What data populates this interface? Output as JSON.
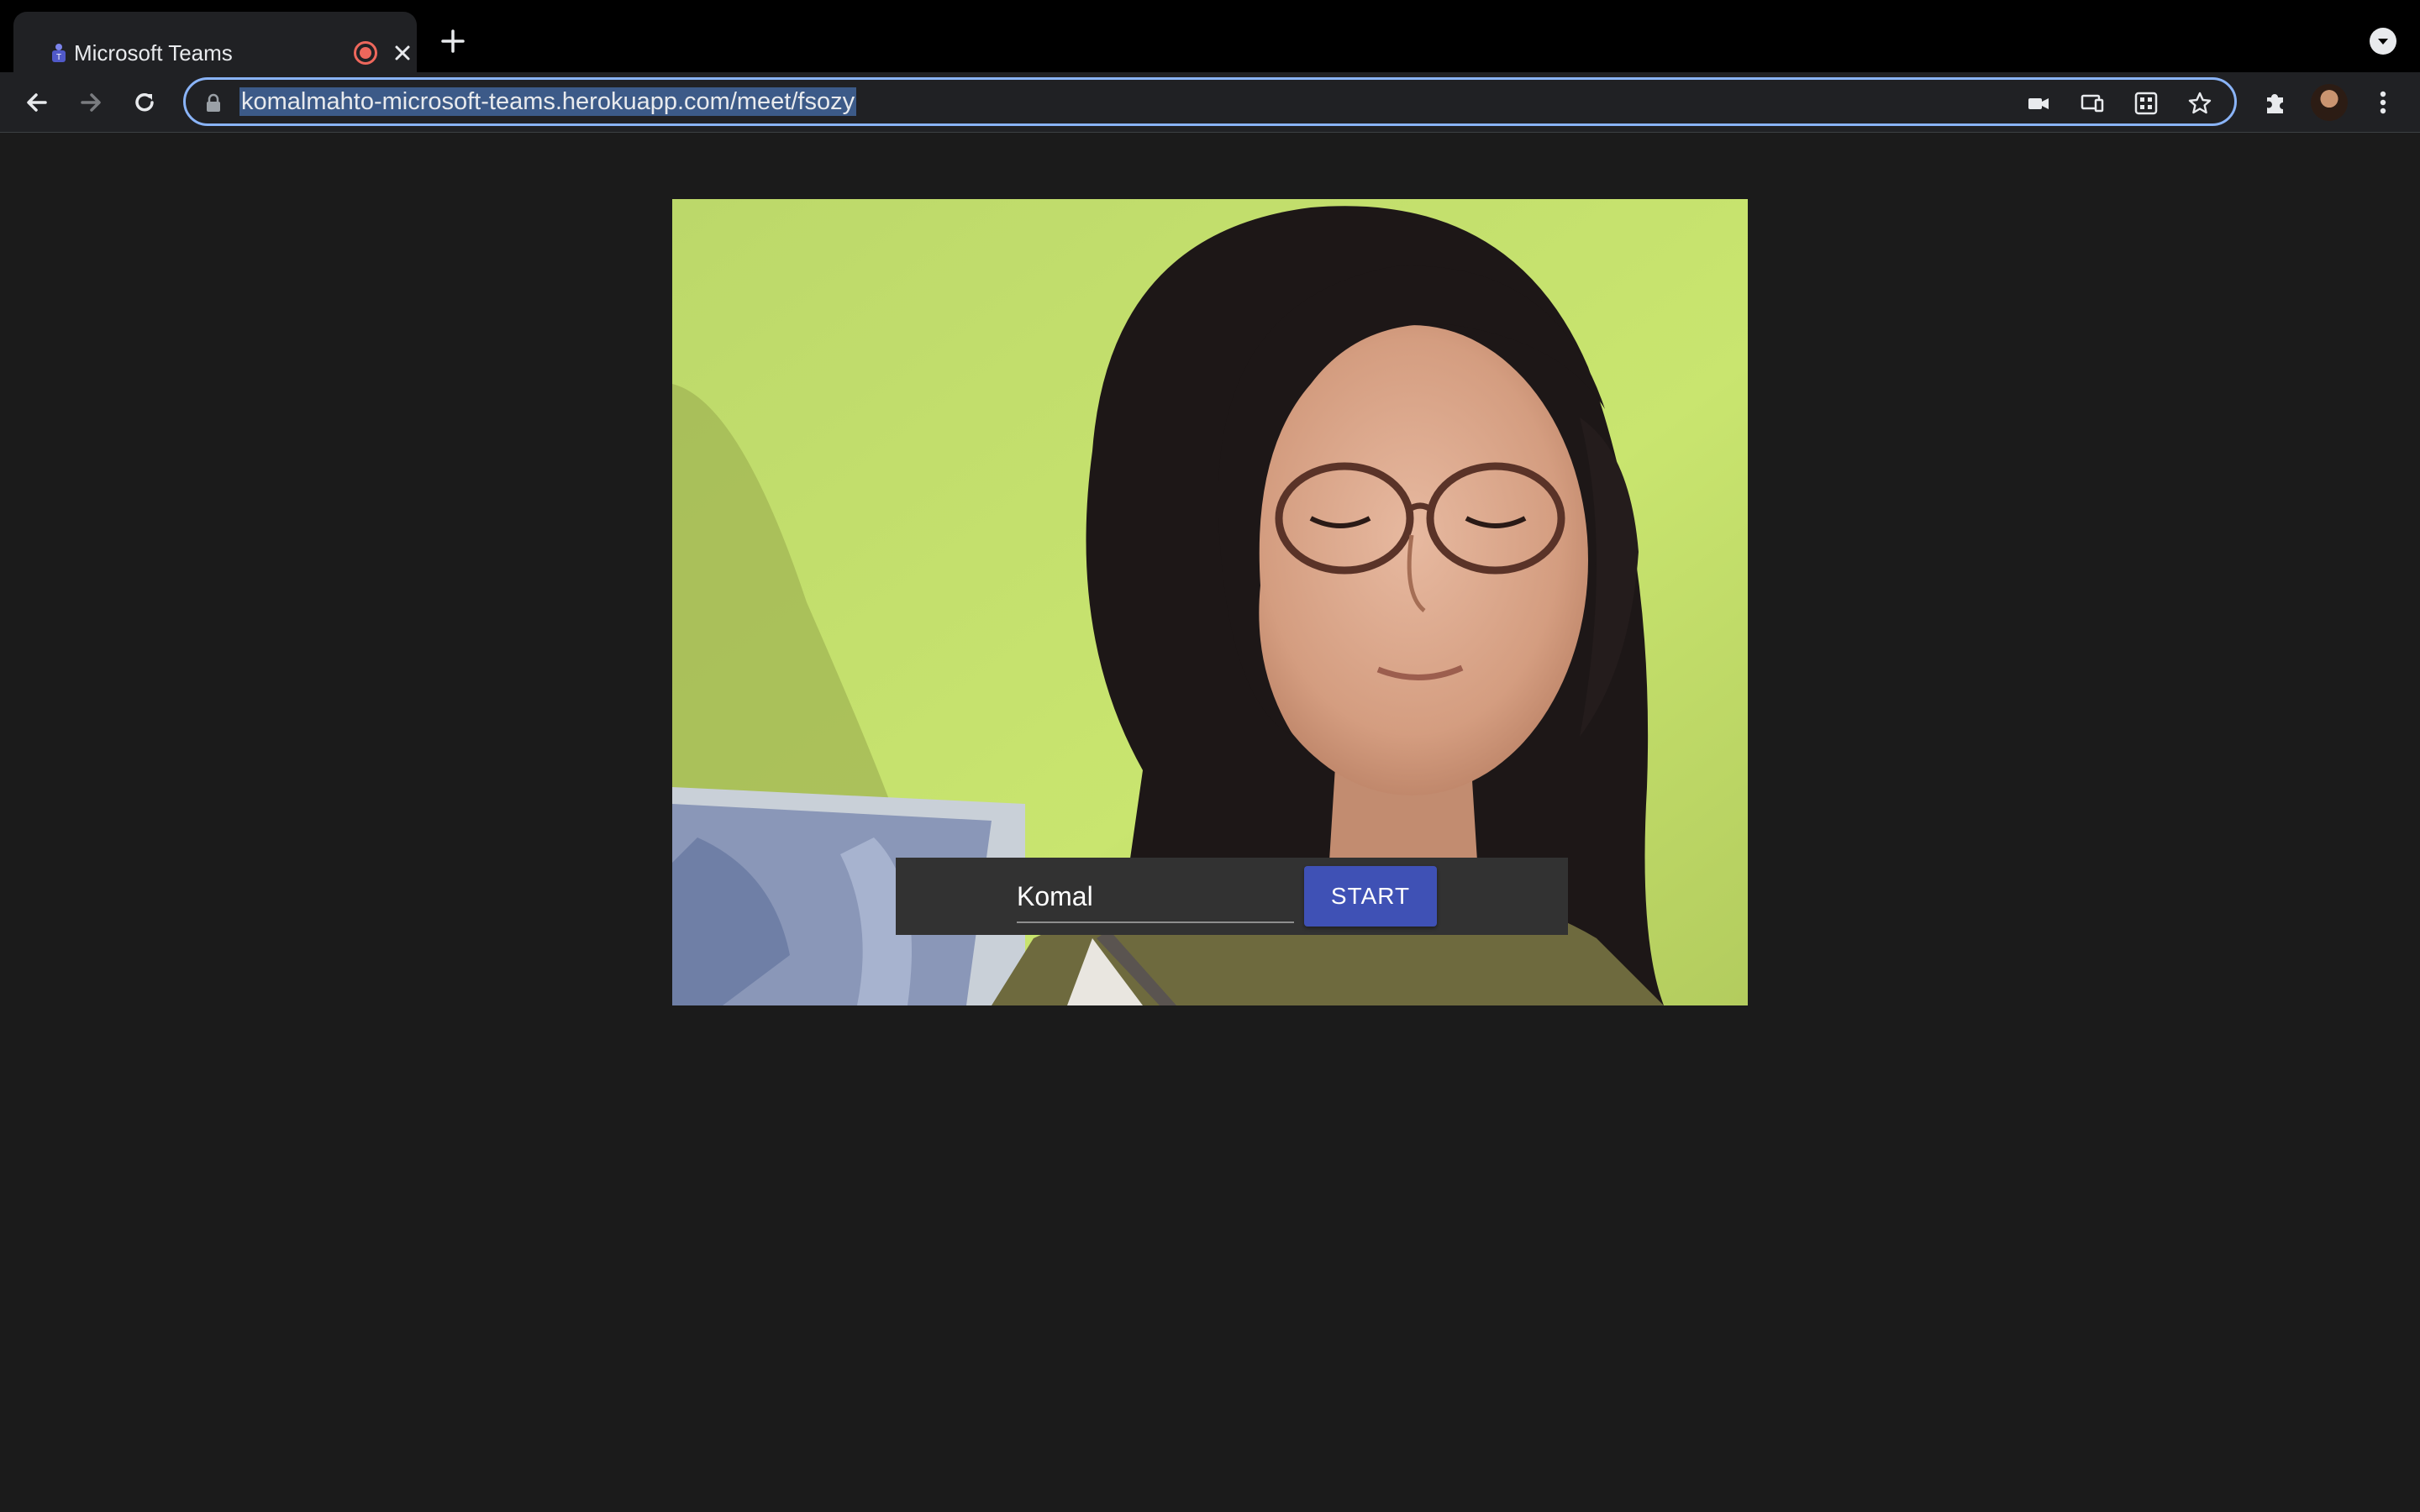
{
  "browser": {
    "tab": {
      "title": "Microsoft Teams",
      "favicon": "teams-logo-icon",
      "indicator": "recording-indicator-icon"
    },
    "address": {
      "url": "komalmahto-microsoft-teams.herokuapp.com/meet/fsozy"
    },
    "toolbar_icons": [
      "back-icon",
      "forward-icon",
      "reload-icon",
      "lock-icon",
      "camera-icon",
      "cast-icon",
      "qr-code-icon",
      "star-icon",
      "extensions-icon",
      "profile-avatar",
      "menu-icon"
    ]
  },
  "meeting": {
    "preview": "camera-preview",
    "name_input": {
      "value": "Komal"
    },
    "start_button": {
      "label": "START"
    }
  },
  "colors": {
    "page_background": "#1b1b1b",
    "tab_strip": "#000000",
    "toolbar": "#202124",
    "focus_ring": "#8ab4f8",
    "start_button": "#3f51b5",
    "join_bar": "#323232",
    "recording": "#ee675c"
  }
}
